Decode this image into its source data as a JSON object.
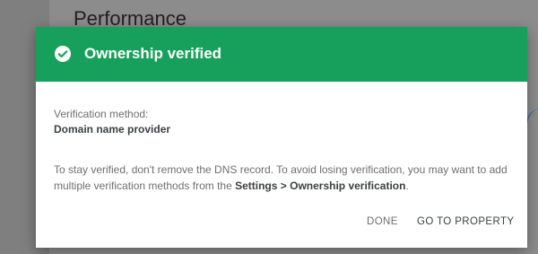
{
  "background": {
    "page_title": "Performance"
  },
  "dialog": {
    "title": "Ownership verified",
    "header_color": "#16a05c",
    "icon": "check-circle-icon",
    "method_label": "Verification method:",
    "method_value": "Domain name provider",
    "body_text_before": "To stay verified, don't remove the DNS record. To avoid losing verification, you may want to add multiple verification methods from the ",
    "body_text_bold": "Settings > Ownership verification",
    "body_text_after": ".",
    "buttons": {
      "done": "DONE",
      "go_to_property": "GO TO PROPERTY"
    }
  }
}
